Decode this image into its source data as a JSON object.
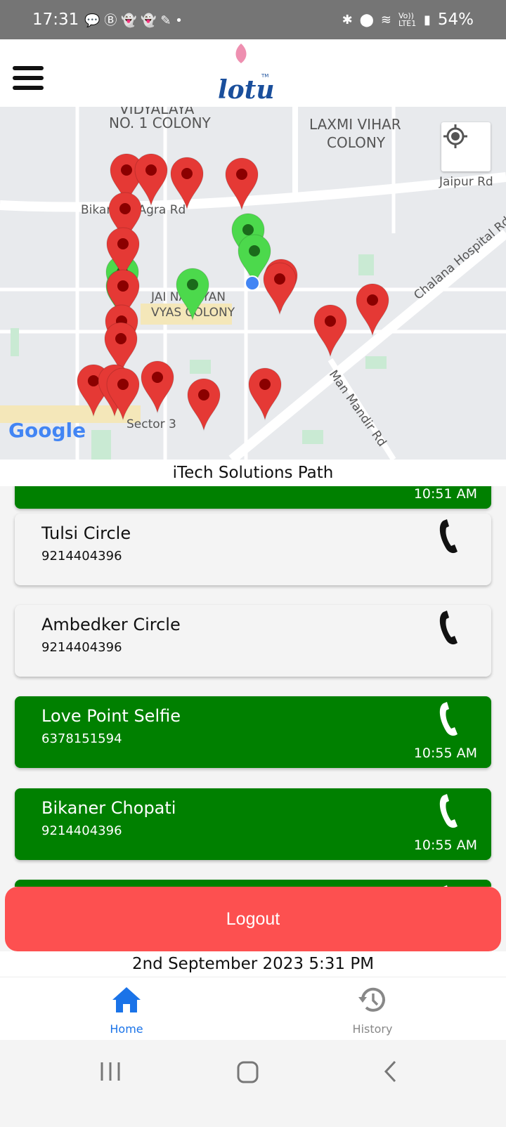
{
  "status_bar": {
    "time": "17:31",
    "battery": "54%",
    "network": "Vo)) LTE1",
    "icons": [
      "chat-icon",
      "b-icon",
      "snapchat-icon",
      "snapchat-icon",
      "feather-icon",
      "dot-icon",
      "bluetooth-icon",
      "location-icon",
      "wifi-icon",
      "signal-icon",
      "battery-icon"
    ]
  },
  "header": {
    "logo": "lotus",
    "logo_tm": "TM",
    "menu_icon": "hamburger-icon"
  },
  "map": {
    "labels": [
      "VIDYALAYA",
      "NO. 1 COLONY",
      "LAXMI VIHAR",
      "COLONY",
      "Jaipur Rd",
      "Bikaner - Agra Rd",
      "Chalana Hospital Rd",
      "JAI NARAYAN",
      "VYAS COLONY",
      "Man Mandir Rd",
      "Sector 3"
    ],
    "google": "Google",
    "locate_icon": "my-location-icon",
    "pin_colors": {
      "visited": "#4cd94c",
      "pending": "#e53935",
      "current": "#4285f4"
    }
  },
  "path_title": "iTech Solutions Path",
  "cards": [
    {
      "name": "",
      "phone": "",
      "time": "10:51 AM",
      "status": "green"
    },
    {
      "name": "Tulsi Circle",
      "phone": "9214404396",
      "time": "",
      "status": "grey"
    },
    {
      "name": "Ambedker Circle",
      "phone": "9214404396",
      "time": "",
      "status": "grey"
    },
    {
      "name": "Love Point Selfie",
      "phone": "6378151594",
      "time": "10:55 AM",
      "status": "green"
    },
    {
      "name": "Bikaner Chopati",
      "phone": "9214404396",
      "time": "10:55 AM",
      "status": "green"
    },
    {
      "name": "",
      "phone": "",
      "time": "",
      "status": "green"
    }
  ],
  "logout_label": "Logout",
  "datetime": "2nd September 2023 5:31 PM",
  "bottom_nav": [
    {
      "label": "Home",
      "active": true,
      "color": "#1a73e8"
    },
    {
      "label": "History",
      "active": false,
      "color": "#888888"
    }
  ],
  "colors": {
    "green_card": "#008000",
    "logout": "#fd5050"
  }
}
